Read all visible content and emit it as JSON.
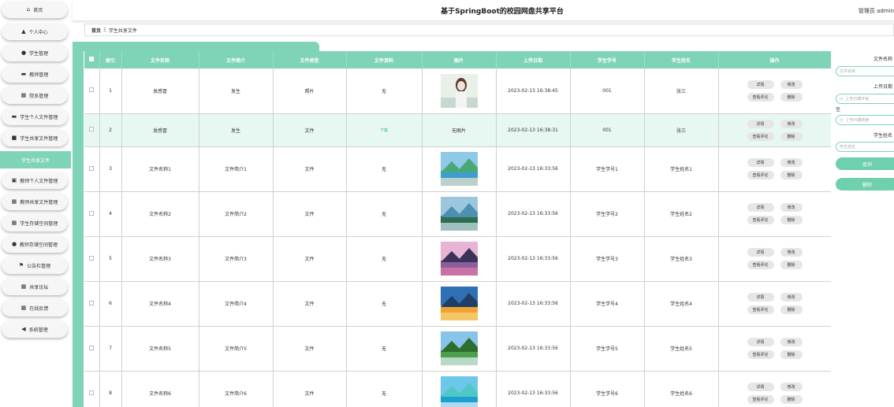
{
  "header": {
    "title": "基于SpringBoot的校园网盘共享平台",
    "admin": "管理员 admin"
  },
  "breadcrumb": {
    "home": "首页",
    "sep": "Ξ",
    "current": "学生共享文件"
  },
  "sidebar": {
    "items": [
      {
        "icon": "home-icon",
        "glyph": "⌂",
        "label": "首页"
      },
      {
        "icon": "user-icon",
        "glyph": "▲",
        "label": "个人中心"
      },
      {
        "icon": "student-icon",
        "glyph": "●",
        "label": "学生管理"
      },
      {
        "icon": "teacher-icon",
        "glyph": "▬",
        "label": "教师管理"
      },
      {
        "icon": "grid-icon",
        "glyph": "▦",
        "label": "院系管理"
      },
      {
        "icon": "file-icon",
        "glyph": "▬",
        "label": "学生个人文件管理"
      },
      {
        "icon": "share-file-icon",
        "glyph": "■",
        "label": "学生共享文件管理"
      },
      {
        "icon": "",
        "glyph": "",
        "label": "学生共享文件"
      },
      {
        "icon": "file-icon",
        "glyph": "▣",
        "label": "教师个人文件管理"
      },
      {
        "icon": "grid-icon",
        "glyph": "▦",
        "label": "教师共享文件管理"
      },
      {
        "icon": "grid-icon",
        "glyph": "▦",
        "label": "学生存储空间管理"
      },
      {
        "icon": "storage-icon",
        "glyph": "●",
        "label": "教师存储空间管理"
      },
      {
        "icon": "flag-icon",
        "glyph": "⚑",
        "label": "公告栏管理"
      },
      {
        "icon": "grid-icon",
        "glyph": "▦",
        "label": "共享论坛"
      },
      {
        "icon": "grid-icon",
        "glyph": "▦",
        "label": "在线反馈"
      },
      {
        "icon": "settings-icon",
        "glyph": "◀",
        "label": "系统管理"
      }
    ]
  },
  "table": {
    "headers": [
      "索引",
      "文件名称",
      "文件简介",
      "文件类型",
      "文件资料",
      "图片",
      "上传日期",
      "学生学号",
      "学生姓名",
      "操作"
    ],
    "rows": [
      {
        "index": "1",
        "name": "发感冒",
        "intro": "发生",
        "type": "照片",
        "material": "无",
        "image": "woman",
        "date": "2023-02-13 16:38:45",
        "sno": "001",
        "sname": "张三"
      },
      {
        "index": "2",
        "name": "发感冒",
        "intro": "发生",
        "type": "文件",
        "material": "下载",
        "image": "无图片",
        "date": "2023-02-13 16:38:31",
        "sno": "001",
        "sname": "张三"
      },
      {
        "index": "3",
        "name": "文件名称1",
        "intro": "文件简介1",
        "type": "文件",
        "material": "无",
        "image": "beach",
        "date": "2023-02-13 16:33:56",
        "sno": "学生学号1",
        "sname": "学生姓名1"
      },
      {
        "index": "4",
        "name": "文件名称2",
        "intro": "文件简介2",
        "type": "文件",
        "material": "无",
        "image": "lake",
        "date": "2023-02-13 16:33:56",
        "sno": "学生学号2",
        "sname": "学生姓名2"
      },
      {
        "index": "5",
        "name": "文件名称3",
        "intro": "文件简介3",
        "type": "文件",
        "material": "无",
        "image": "sunset",
        "date": "2023-02-13 16:33:56",
        "sno": "学生学号3",
        "sname": "学生姓名3"
      },
      {
        "index": "6",
        "name": "文件名称4",
        "intro": "文件简介4",
        "type": "文件",
        "material": "无",
        "image": "orange",
        "date": "2023-02-13 16:33:56",
        "sno": "学生学号4",
        "sname": "学生姓名4"
      },
      {
        "index": "7",
        "name": "文件名称5",
        "intro": "文件简介5",
        "type": "文件",
        "material": "无",
        "image": "field",
        "date": "2023-02-13 16:33:56",
        "sno": "学生学号5",
        "sname": "学生姓名5"
      },
      {
        "index": "8",
        "name": "文件名称6",
        "intro": "文件简介6",
        "type": "文件",
        "material": "无",
        "image": "tropic",
        "date": "2023-02-13 16:33:56",
        "sno": "学生学号6",
        "sname": "学生姓名6"
      }
    ],
    "ops": {
      "detail": "详情",
      "edit": "修改",
      "comments": "查看评论",
      "delete": "删除"
    }
  },
  "search": {
    "name_label": "文件名称",
    "name_placeholder": "文件名称",
    "date_label": "上传日期",
    "date_start_placeholder": "上传日期开始",
    "to_label": "至",
    "date_end_placeholder": "上传日期结束",
    "sname_label": "学生姓名",
    "sname_placeholder": "学生姓名",
    "query_button": "查询",
    "delete_button": "删除"
  },
  "colors": {
    "accent": "#7fd3b6",
    "button": "#6fd0ad",
    "highlight_row": "#e7f7f1"
  }
}
